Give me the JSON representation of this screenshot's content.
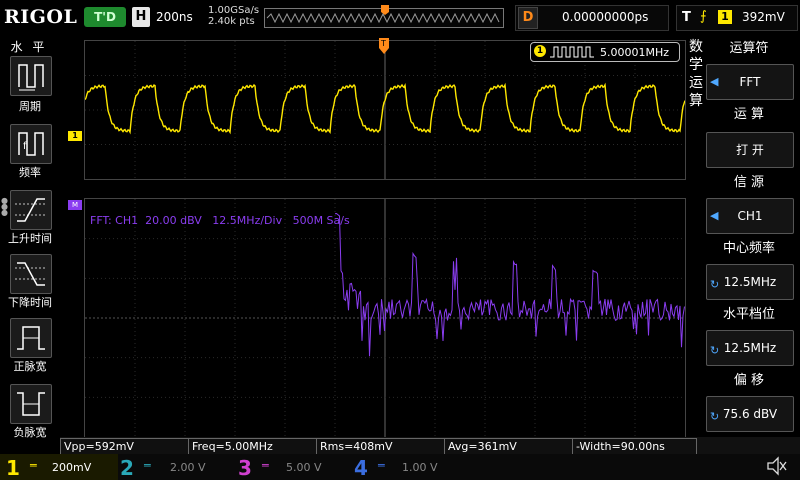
{
  "topbar": {
    "logo": "RIGOL",
    "trigger_status": "T'D",
    "horizontal_label": "H",
    "timebase": "200ns",
    "sample_rate": "1.00GSa/s",
    "memory_depth": "2.40k pts",
    "delay_label": "D",
    "delay_value": "0.00000000ps",
    "trigger_label": "T",
    "trigger_edge": "⨍",
    "trigger_source": "1",
    "trigger_level": "392mV"
  },
  "left_menu": {
    "title": "水 平",
    "items": [
      {
        "label": "周期",
        "icon": "period-icon"
      },
      {
        "label": "频率",
        "icon": "frequency-icon"
      },
      {
        "label": "上升时间",
        "icon": "rise-time-icon"
      },
      {
        "label": "下降时间",
        "icon": "fall-time-icon"
      },
      {
        "label": "正脉宽",
        "icon": "positive-width-icon"
      },
      {
        "label": "负脉宽",
        "icon": "negative-width-icon"
      }
    ]
  },
  "screen": {
    "freq_counter": "5.00001MHz",
    "ch1_marker": "1",
    "math_marker": "M",
    "fft_label": "FFT: CH1  20.00 dBV   12.5MHz/Div   500M Sa/s",
    "vertical_label": [
      "数",
      "学",
      "运",
      "算"
    ]
  },
  "right_menu": {
    "operator_title": "运算符",
    "operator_value": "FFT",
    "operation_title": "运 算",
    "operation_value": "打 开",
    "source_title": "信 源",
    "source_value": "CH1",
    "center_title": "中心频率",
    "center_value": "12.5MHz",
    "hscale_title": "水平档位",
    "hscale_value": "12.5MHz",
    "offset_title": "偏 移",
    "offset_value": "75.6 dBV"
  },
  "measurements": [
    {
      "text": "Vpp=592mV"
    },
    {
      "text": "Freq=5.00MHz"
    },
    {
      "text": "Rms=408mV"
    },
    {
      "text": "Avg=361mV"
    },
    {
      "text": "-Width=90.00ns"
    }
  ],
  "channels": [
    {
      "num": "1",
      "coupling": "═",
      "scale": "200mV",
      "color": "#ffe800"
    },
    {
      "num": "2",
      "coupling": "═",
      "scale": "2.00 V",
      "color": "#2aa8b8"
    },
    {
      "num": "3",
      "coupling": "═",
      "scale": "5.00 V",
      "color": "#d040d0"
    },
    {
      "num": "4",
      "coupling": "═",
      "scale": "1.00 V",
      "color": "#3b6ee0"
    }
  ],
  "colors": {
    "ch1": "#ffe800",
    "math": "#8a3df0",
    "trigger": "#ff8a1a",
    "accent": "#4fa8ff"
  }
}
